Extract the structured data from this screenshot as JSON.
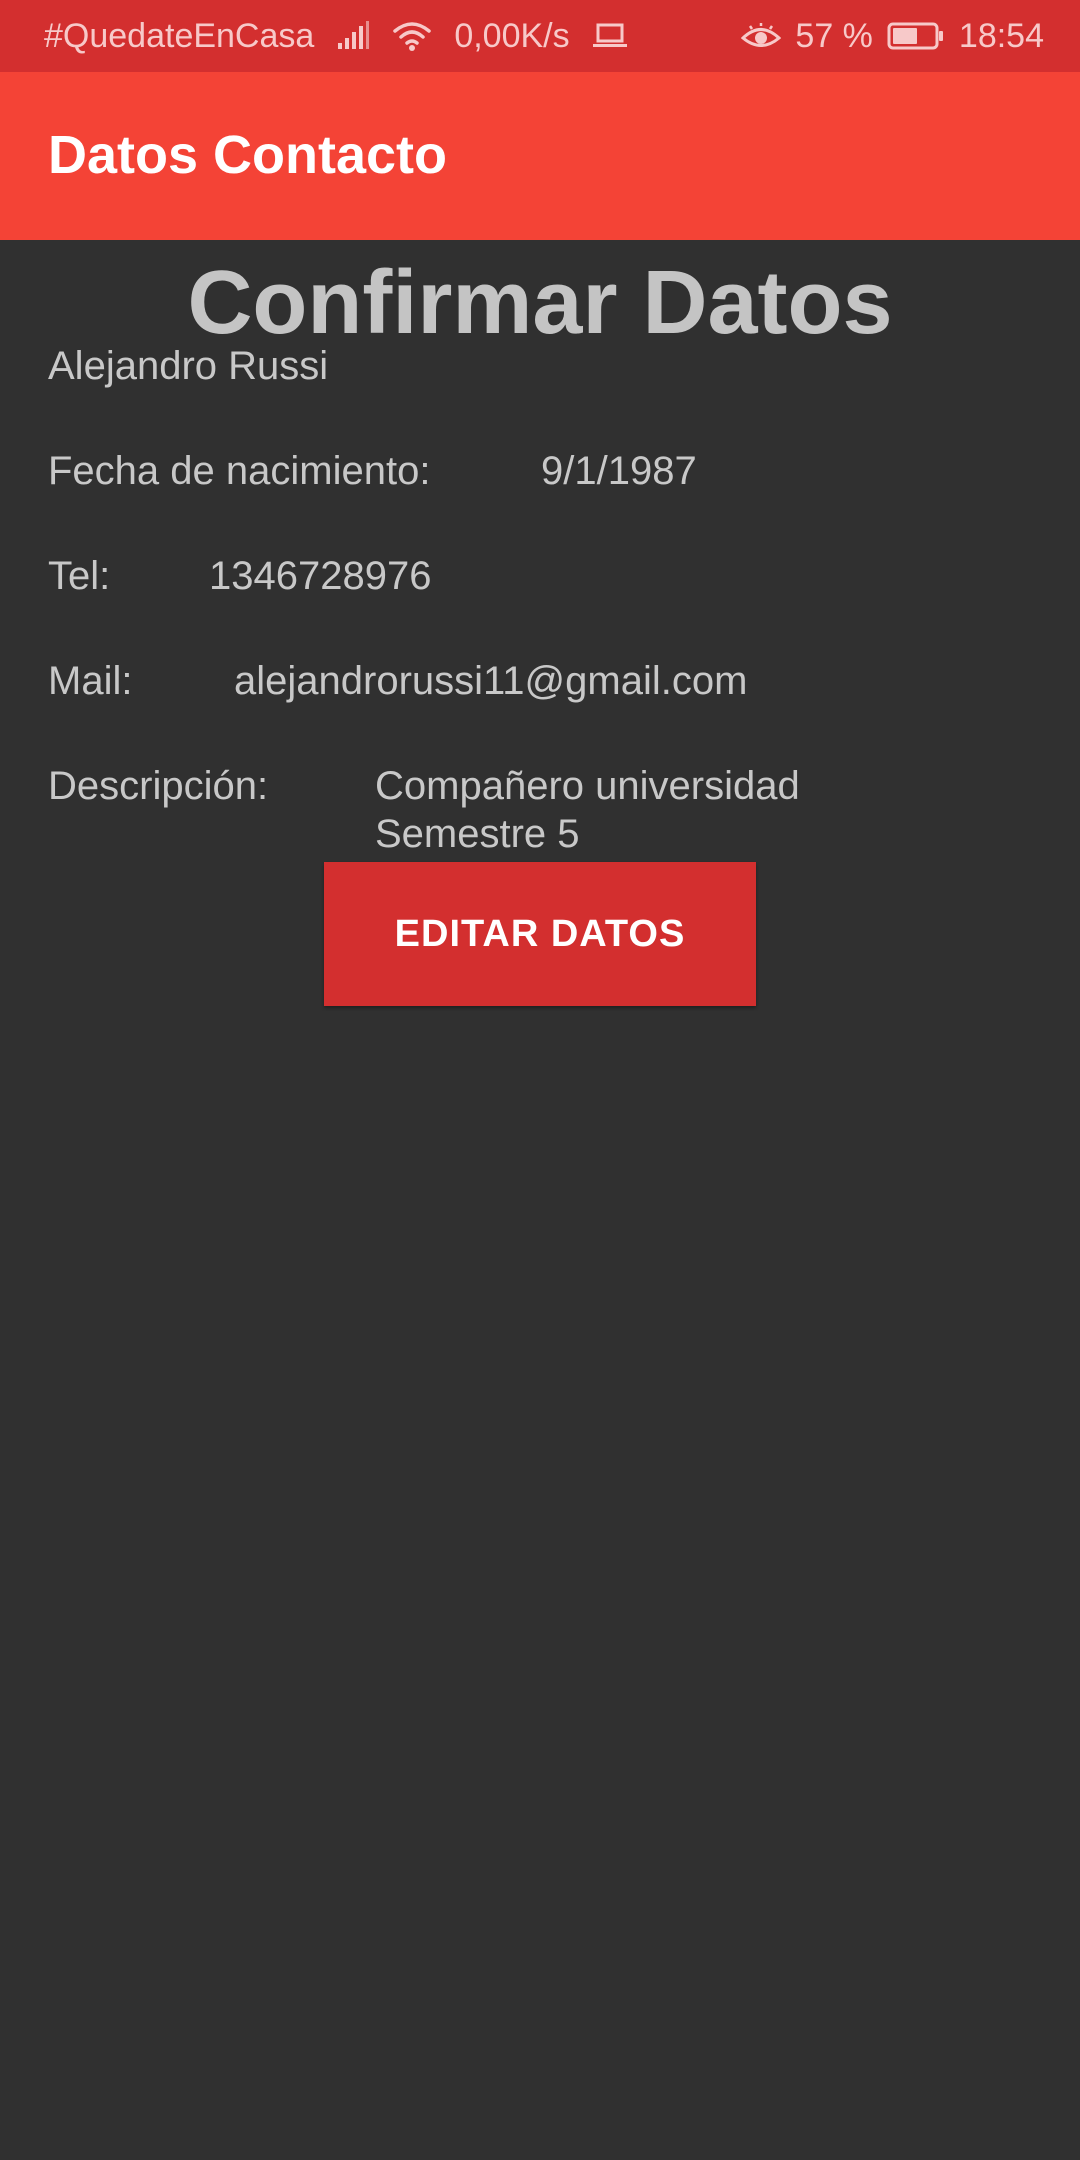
{
  "status_bar": {
    "carrier_text": "#QuedateEnCasa",
    "net_speed": "0,00K/s",
    "battery_percent": "57 %",
    "time": "18:54",
    "icons": [
      "signal-icon",
      "wifi-icon",
      "laptop-icon",
      "eye-icon",
      "battery-icon"
    ]
  },
  "app_bar": {
    "title": "Datos Contacto"
  },
  "content": {
    "title": "Confirmar Datos",
    "name": "Alejandro Russi",
    "birth_label": "Fecha de nacimiento:",
    "birth_value": "9/1/1987",
    "tel_label": "Tel:",
    "tel_value": "1346728976",
    "mail_label": "Mail:",
    "mail_value": "alejandrorussi11@gmail.com",
    "desc_label": "Descripción:",
    "desc_line1": "Compañero universidad",
    "desc_line2": "Semestre 5"
  },
  "button": {
    "label": "EDITAR DATOS"
  },
  "colors": {
    "status_bar": "#d32f2f",
    "app_bar": "#f44336",
    "background": "#303030",
    "button": "#d32f2f",
    "text": "#c8c8c8"
  }
}
